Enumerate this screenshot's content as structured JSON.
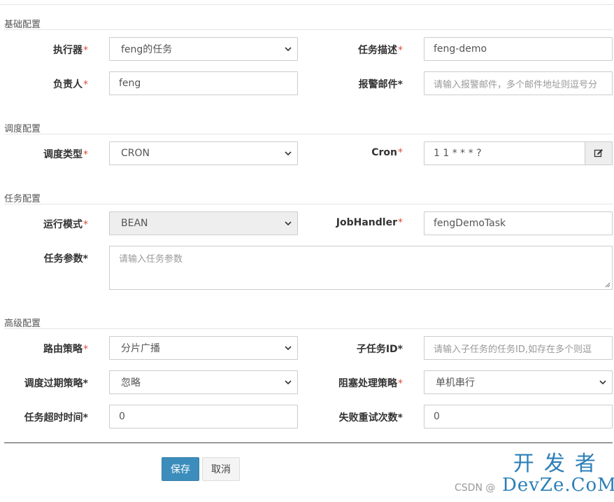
{
  "sections": {
    "basic": "基础配置",
    "schedule": "调度配置",
    "task": "任务配置",
    "advanced": "高级配置"
  },
  "basic": {
    "executor_label": "执行器",
    "executor_value": "feng的任务",
    "desc_label": "任务描述",
    "desc_value": "feng-demo",
    "owner_label": "负责人",
    "owner_value": "feng",
    "email_label": "报警邮件",
    "email_placeholder": "请输入报警邮件，多个邮件地址则逗号分"
  },
  "schedule": {
    "type_label": "调度类型",
    "type_value": "CRON",
    "cron_label": "Cron",
    "cron_value": "1 1 * * * ?"
  },
  "task": {
    "mode_label": "运行模式",
    "mode_value": "BEAN",
    "handler_label": "JobHandler",
    "handler_value": "fengDemoTask",
    "param_label": "任务参数",
    "param_placeholder": "请输入任务参数"
  },
  "advanced": {
    "route_label": "路由策略",
    "route_value": "分片广播",
    "child_label": "子任务ID",
    "child_placeholder": "请输入子任务的任务ID,如存在多个则逗",
    "misfire_label": "调度过期策略",
    "misfire_value": "忽略",
    "block_label": "阻塞处理策略",
    "block_value": "单机串行",
    "timeout_label": "任务超时时间",
    "timeout_value": "0",
    "retry_label": "失败重试次数",
    "retry_value": "0"
  },
  "actions": {
    "save": "保存",
    "cancel": "取消"
  },
  "marks": {
    "required": "*",
    "star": "*"
  },
  "watermark": {
    "csdn": "CSDN @",
    "brand_cn": "开发者",
    "brand_en": "DevZe.CoM"
  }
}
